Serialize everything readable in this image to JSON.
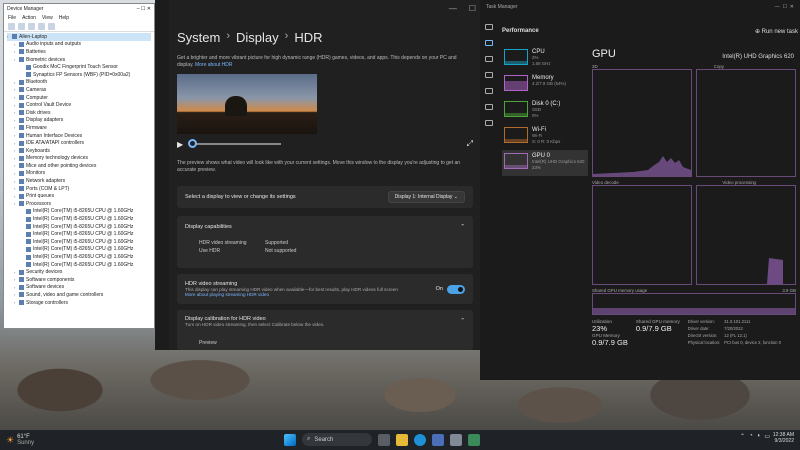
{
  "device_manager": {
    "title": "Device Manager",
    "menu": [
      "File",
      "Action",
      "View",
      "Help"
    ],
    "tree": [
      {
        "label": "Allen-Laptop",
        "level": 0,
        "selected": true
      },
      {
        "label": "Audio inputs and outputs",
        "level": 1
      },
      {
        "label": "Batteries",
        "level": 1
      },
      {
        "label": "Biometric devices",
        "level": 1
      },
      {
        "label": "Goodix MoC Fingerprint Touch Sensor",
        "level": 2
      },
      {
        "label": "Synaptics FP Sensors (WBF) (PID=0x00a2)",
        "level": 2
      },
      {
        "label": "Bluetooth",
        "level": 1
      },
      {
        "label": "Cameras",
        "level": 1
      },
      {
        "label": "Computer",
        "level": 1
      },
      {
        "label": "Control Vault Device",
        "level": 1
      },
      {
        "label": "Disk drives",
        "level": 1
      },
      {
        "label": "Display adapters",
        "level": 1
      },
      {
        "label": "Firmware",
        "level": 1
      },
      {
        "label": "Human Interface Devices",
        "level": 1
      },
      {
        "label": "IDE ATA/ATAPI controllers",
        "level": 1
      },
      {
        "label": "Keyboards",
        "level": 1
      },
      {
        "label": "Memory technology devices",
        "level": 1
      },
      {
        "label": "Mice and other pointing devices",
        "level": 1
      },
      {
        "label": "Monitors",
        "level": 1
      },
      {
        "label": "Network adapters",
        "level": 1
      },
      {
        "label": "Ports (COM & LPT)",
        "level": 1
      },
      {
        "label": "Print queues",
        "level": 1
      },
      {
        "label": "Processors",
        "level": 1
      },
      {
        "label": "Intel(R) Core(TM) i5-8265U CPU @ 1.60GHz",
        "level": 2
      },
      {
        "label": "Intel(R) Core(TM) i5-8265U CPU @ 1.60GHz",
        "level": 2
      },
      {
        "label": "Intel(R) Core(TM) i5-8265U CPU @ 1.60GHz",
        "level": 2
      },
      {
        "label": "Intel(R) Core(TM) i5-8265U CPU @ 1.60GHz",
        "level": 2
      },
      {
        "label": "Intel(R) Core(TM) i5-8265U CPU @ 1.60GHz",
        "level": 2
      },
      {
        "label": "Intel(R) Core(TM) i5-8265U CPU @ 1.60GHz",
        "level": 2
      },
      {
        "label": "Intel(R) Core(TM) i5-8265U CPU @ 1.60GHz",
        "level": 2
      },
      {
        "label": "Intel(R) Core(TM) i5-8265U CPU @ 1.60GHz",
        "level": 2
      },
      {
        "label": "Security devices",
        "level": 1
      },
      {
        "label": "Software components",
        "level": 1
      },
      {
        "label": "Software devices",
        "level": 1
      },
      {
        "label": "Sound, video and game controllers",
        "level": 1
      },
      {
        "label": "Storage controllers",
        "level": 1
      }
    ]
  },
  "settings": {
    "breadcrumb": [
      "System",
      "Display",
      "HDR"
    ],
    "description": "Get a brighter and more vibrant picture for high dynamic range (HDR) games, videos, and apps. This depends on your PC and display.",
    "description_link": "More about HDR",
    "video_note": "The preview shows what video will look like with your current settings. Move this window to the display you're adjusting to get an accurate preview.",
    "select_label": "Select a display to view or change its settings",
    "select_value": "Display 1: Internal Display",
    "capabilities_title": "Display capabilities",
    "capabilities": [
      {
        "key": "HDR video streaming",
        "value": "Supported"
      },
      {
        "key": "Use HDR",
        "value": "Not supported"
      }
    ],
    "stream_title": "HDR video streaming",
    "stream_sub": "This display can play streaming HDR video when available—for best results, play HDR videos full screen",
    "stream_link": "More about playing streaming HDR video",
    "stream_state": "On",
    "calibration_title": "Display calibration for HDR video",
    "calibration_sub": "Turn on HDR video streaming, then select Calibrate below the video.",
    "preview_label": "Preview"
  },
  "task_manager": {
    "title": "Task Manager",
    "section": "Performance",
    "run_task": "Run new task",
    "items": [
      {
        "label": "CPU",
        "line1": "2%",
        "line2": "1.68 GHz",
        "color": "#17a2c8"
      },
      {
        "label": "Memory",
        "line1": "4.2/7.8 GB (54%)",
        "line2": "",
        "color": "#b063c9"
      },
      {
        "label": "Disk 0 (C:)",
        "line1": "SSD",
        "line2": "0%",
        "color": "#4ca43a"
      },
      {
        "label": "Wi-Fi",
        "line1": "Wi-Fi",
        "line2": "S: 0 R: 0 Kbps",
        "color": "#b06a2c"
      },
      {
        "label": "GPU 0",
        "line1": "Intel(R) UHD Graphics 620",
        "line2": "23%",
        "color": "#a06ab4"
      }
    ],
    "gpu": {
      "title": "GPU",
      "name": "Intel(R) UHD Graphics 620",
      "graph1_left": "3D",
      "graph1_right": "Copy",
      "graph2_left": "Video decode",
      "graph2_right": "Video processing",
      "shared_label": "Shared GPU memory usage",
      "shared_max": "3.9 GB",
      "utilization_label": "Utilization",
      "utilization_value": "23%",
      "shared_mem_label": "Shared GPU memory",
      "shared_mem_value": "0.9/7.9 GB",
      "gpu_mem_label": "GPU Memory",
      "gpu_mem_value": "0.9/7.9 GB",
      "info_keys": [
        "Driver version:",
        "Driver date:",
        "DirectX version:",
        "Physical location:"
      ],
      "info_vals": [
        "31.0.101.2111",
        "7/20/2022",
        "12 (FL 12.1)",
        "PCI bus 0, device 2, function 0"
      ]
    }
  },
  "taskbar": {
    "weather_temp": "61°F",
    "weather_desc": "Sunny",
    "search_label": "Search",
    "time": "12:38 AM",
    "date": "9/3/2022"
  }
}
